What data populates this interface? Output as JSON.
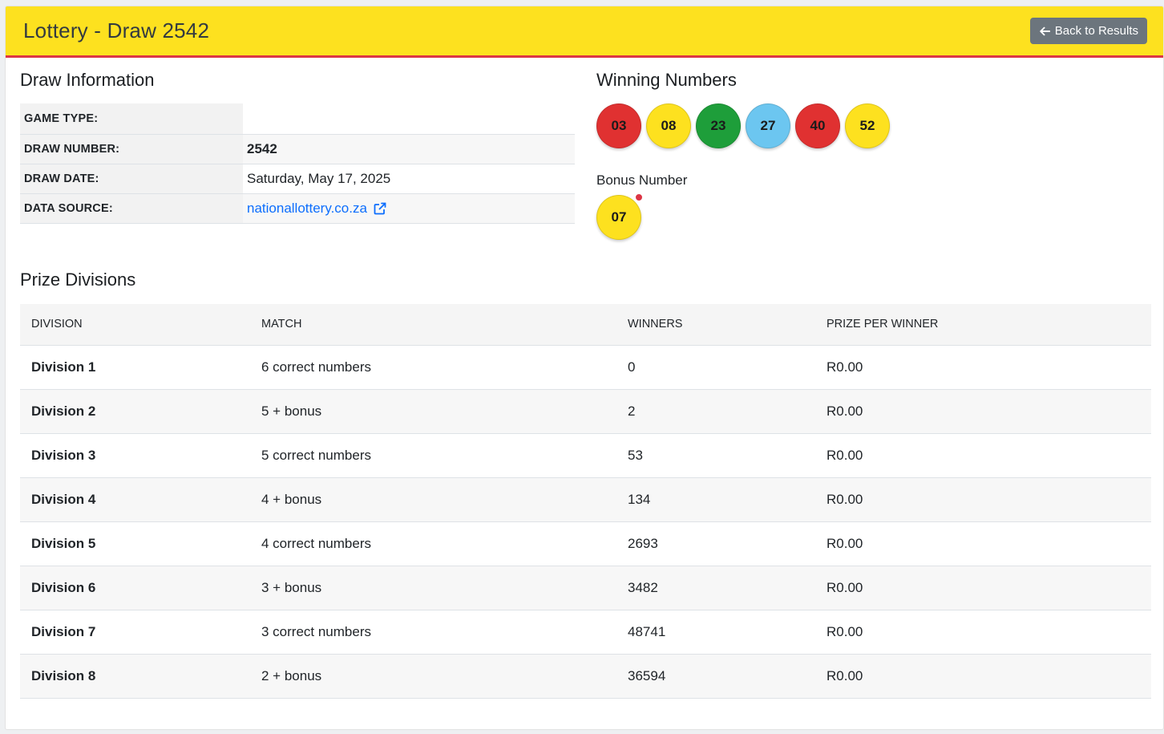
{
  "header": {
    "title": "Lottery - Draw 2542",
    "back_label": "Back to Results"
  },
  "draw_info": {
    "heading": "Draw Information",
    "rows": [
      {
        "key": "GAME TYPE:",
        "value": ""
      },
      {
        "key": "DRAW NUMBER:",
        "value": "2542"
      },
      {
        "key": "DRAW DATE:",
        "value": "Saturday, May 17, 2025"
      },
      {
        "key": "DATA SOURCE:",
        "value": "nationallottery.co.za"
      }
    ]
  },
  "winning": {
    "heading": "Winning Numbers",
    "balls": [
      {
        "n": "03",
        "color": "#e03131"
      },
      {
        "n": "08",
        "color": "#fde11f"
      },
      {
        "n": "23",
        "color": "#1e9e3a"
      },
      {
        "n": "27",
        "color": "#6cc6f0"
      },
      {
        "n": "40",
        "color": "#e03131"
      },
      {
        "n": "52",
        "color": "#fde11f"
      }
    ],
    "bonus_label": "Bonus Number",
    "bonus": {
      "n": "07",
      "color": "#fde11f"
    }
  },
  "prizes": {
    "heading": "Prize Divisions",
    "columns": [
      "DIVISION",
      "MATCH",
      "WINNERS",
      "PRIZE PER WINNER"
    ],
    "rows": [
      [
        "Division 1",
        "6 correct numbers",
        "0",
        "R0.00"
      ],
      [
        "Division 2",
        "5 + bonus",
        "2",
        "R0.00"
      ],
      [
        "Division 3",
        "5 correct numbers",
        "53",
        "R0.00"
      ],
      [
        "Division 4",
        "4 + bonus",
        "134",
        "R0.00"
      ],
      [
        "Division 5",
        "4 correct numbers",
        "2693",
        "R0.00"
      ],
      [
        "Division 6",
        "3 + bonus",
        "3482",
        "R0.00"
      ],
      [
        "Division 7",
        "3 correct numbers",
        "48741",
        "R0.00"
      ],
      [
        "Division 8",
        "2 + bonus",
        "36594",
        "R0.00"
      ]
    ]
  }
}
